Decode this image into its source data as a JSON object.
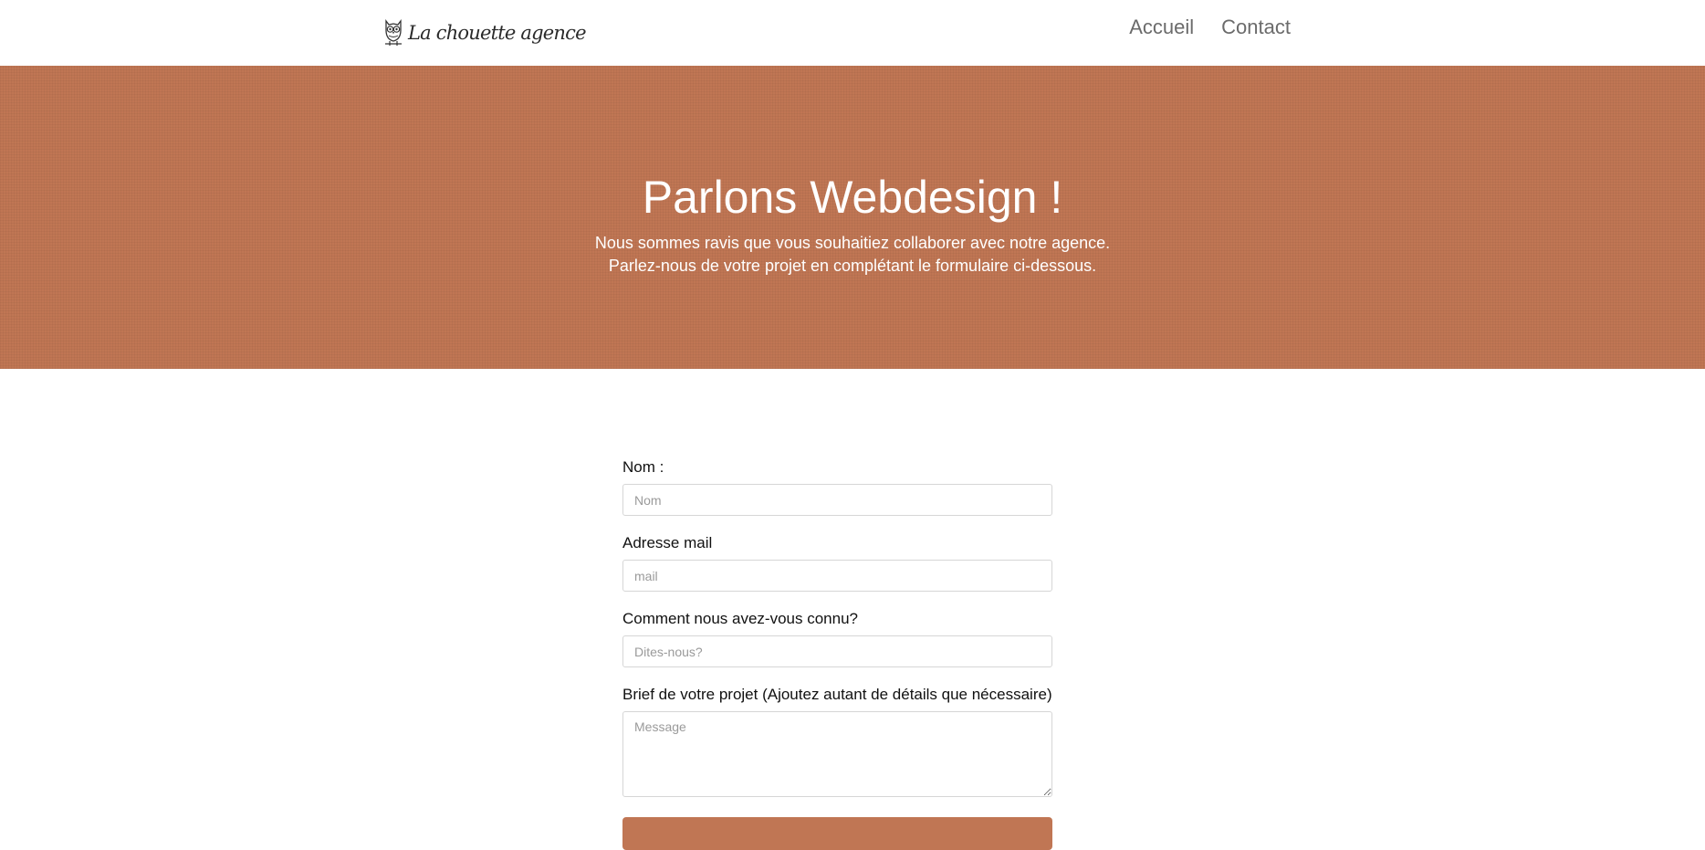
{
  "header": {
    "logo_text": "La chouette agence",
    "logo_icon": "owl-icon",
    "nav": [
      {
        "label": "Accueil"
      },
      {
        "label": "Contact"
      }
    ]
  },
  "hero": {
    "title": "Parlons Webdesign !",
    "subtitle_line1": "Nous sommes ravis que vous souhaitiez collaborer avec notre agence.",
    "subtitle_line2": "Parlez-nous de votre projet en complétant le formulaire ci-dessous.",
    "background_color": "#c07654"
  },
  "form": {
    "name_label": "Nom :",
    "name_placeholder": "Nom",
    "email_label": "Adresse mail",
    "email_placeholder": "mail",
    "source_label": "Comment nous avez-vous connu?",
    "source_placeholder": "Dites-nous?",
    "brief_label": "Brief de votre projet (Ajoutez autant de détails que nécessaire)",
    "brief_placeholder": "Message",
    "submit_label": ""
  },
  "colors": {
    "accent": "#c07654",
    "nav_text": "#6b6b6b"
  }
}
